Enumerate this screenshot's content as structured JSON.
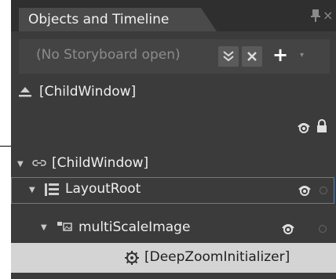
{
  "panel": {
    "tab_title": "Objects and Timeline",
    "close_glyph": "×"
  },
  "storyboard": {
    "status": "(No Storyboard open)",
    "add_glyph": "+",
    "menu_glyph": "▾"
  },
  "tree": {
    "root_label": "[ChildWindow]",
    "child_label": "[ChildWindow]",
    "layout_label": "LayoutRoot",
    "msi_label": "multiScaleImage",
    "dz_label": "[DeepZoomInitializer]"
  },
  "colors": {
    "panel_bg": "#3b3b3b",
    "selection_border": "#4f7fbf",
    "highlight_row": "#d4d4d4"
  }
}
